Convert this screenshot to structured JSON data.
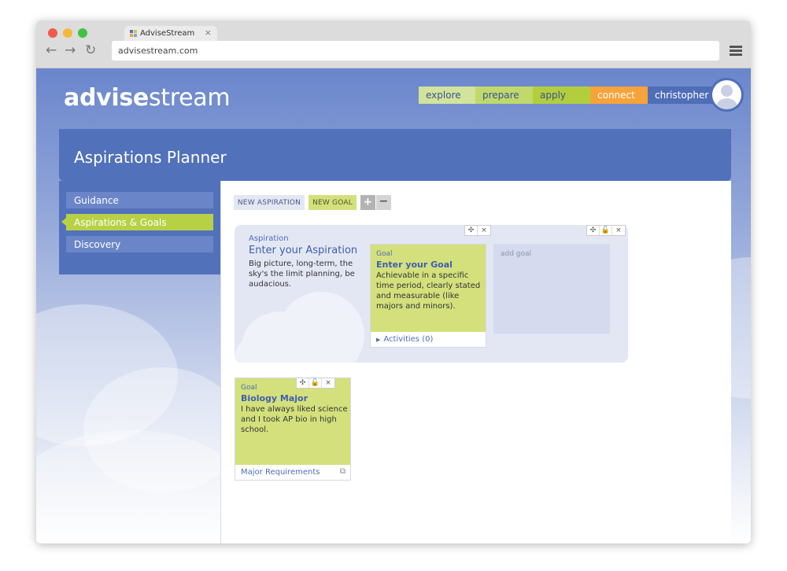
{
  "browser": {
    "tab_title": "AdviseStream",
    "tab_close": "×",
    "url": "advisestream.com",
    "back_glyph": "←",
    "forward_glyph": "→",
    "reload_glyph": "↻"
  },
  "app": {
    "logo_bold": "advise",
    "logo_light": "stream",
    "nav": {
      "explore": "explore",
      "prepare": "prepare",
      "apply": "apply",
      "connect": "connect",
      "user": "christopher"
    },
    "page_title": "Aspirations Planner"
  },
  "sidebar": {
    "items": [
      "Guidance",
      "Aspirations & Goals",
      "Discovery"
    ]
  },
  "toolbar": {
    "new_aspiration": "NEW ASPIRATION",
    "new_goal": "NEW GOAL",
    "plus": "+",
    "minus": "−"
  },
  "aspiration": {
    "label": "Aspiration",
    "title": "Enter your Aspiration",
    "desc": "Big picture, long-term, the sky's the limit planning, be audacious.",
    "goal": {
      "label": "Goal",
      "title": "Enter your Goal",
      "desc": "Achievable in a specific time period, clearly stated and measurable (like majors and minors).",
      "footer": "Activities (0)"
    },
    "add_goal": "add goal"
  },
  "goal2": {
    "label": "Goal",
    "title": "Biology Major",
    "desc": "I have always liked science and I took AP bio in high school.",
    "footer": "Major Requirements"
  },
  "icons": {
    "move": "✣",
    "lock": "🔓",
    "close": "×",
    "external": "⧉"
  },
  "colors": {
    "brand_blue": "#5271bb",
    "lime": "#b8d144",
    "orange": "#f6a33a"
  }
}
